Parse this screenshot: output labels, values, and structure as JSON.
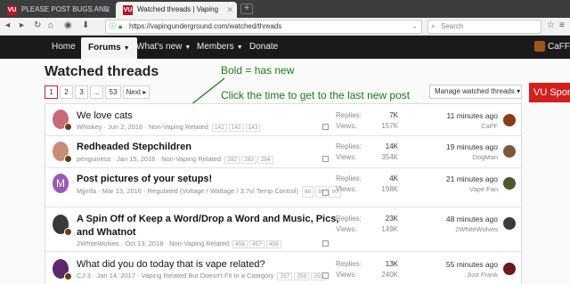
{
  "browser": {
    "tabs": [
      {
        "title": "PLEASE POST BUGS AND",
        "favicon": "VU"
      },
      {
        "title": "Watched threads | Vaping",
        "favicon": "VU"
      }
    ],
    "url": "https://vapingunderground.com/watched/threads",
    "search_placeholder": "Search"
  },
  "nav": {
    "items": [
      "Home",
      "Forums",
      "What's new",
      "Members",
      "Donate"
    ],
    "active": "Forums",
    "user": "CaFF"
  },
  "page": {
    "title": "Watched threads",
    "pagination": [
      "1",
      "2",
      "3",
      "...",
      "53"
    ],
    "next_label": "Next",
    "manage_label": "Manage watched threads",
    "sponsor_label": "VU Sponsors"
  },
  "annotations": {
    "bold_note": "Bold = has new",
    "time_note": "Click the time to get to the last new post"
  },
  "labels": {
    "replies": "Replies:",
    "views": "Views:"
  },
  "threads": [
    {
      "title": "We love cats",
      "bold": false,
      "author": "Whiskey",
      "date": "Jun 2, 2016",
      "forum": "Non-Vaping Related",
      "pages": [
        "141",
        "142",
        "143"
      ],
      "replies": "7K",
      "views": "157K",
      "when": "11 minutes ago",
      "last_user": "CaFF",
      "avatar_color": "#c66b7a",
      "last_color": "#8a3a1a"
    },
    {
      "title": "Redheaded Stepchildren",
      "bold": true,
      "author": "penguiness",
      "date": "Jan 15, 2016",
      "forum": "Non-Vaping Related",
      "pages": [
        "282",
        "283",
        "284"
      ],
      "replies": "14K",
      "views": "354K",
      "when": "19 minutes ago",
      "last_user": "DogMan",
      "avatar_color": "#c98c78",
      "last_color": "#7a5a3a"
    },
    {
      "title": "Post pictures of your setups!",
      "bold": true,
      "author": "Mjjmfa",
      "date": "Mar 13, 2016",
      "forum": "Regulated (Voltage / Wattage / 3.7v/ Temp Control)",
      "pages": [
        "88",
        "89",
        "90"
      ],
      "replies": "4K",
      "views": "198K",
      "when": "21 minutes ago",
      "last_user": "Vape Fan",
      "avatar_letter": "M",
      "last_color": "#4a5a2a"
    },
    {
      "title": "A Spin Off of Keep a Word/Drop a Word and Music, Pics, and Whatnot",
      "bold": true,
      "author": "2WhiteWolves",
      "date": "Oct 13, 2018",
      "forum": "Non-Vaping Related",
      "pages": [
        "456",
        "457",
        "458"
      ],
      "replies": "23K",
      "views": "149K",
      "when": "48 minutes ago",
      "last_user": "2WhiteWolves",
      "avatar_color": "#3a3a3a",
      "last_color": "#3a3a3a"
    },
    {
      "title": "What did you do today that is vape related?",
      "bold": false,
      "author": "CJ-3",
      "date": "Jan 14, 2017",
      "forum": "Vaping Related But Doesn't Fit In a Category",
      "pages": [
        "257",
        "258",
        "259"
      ],
      "replies": "13K",
      "views": "240K",
      "when": "55 minutes ago",
      "last_user": "Just Frank",
      "avatar_color": "#5a2a6a",
      "last_color": "#6a1a1a"
    }
  ],
  "colors": {
    "accent": "#b9262f",
    "annotation": "#1e7d1e",
    "nav_bg": "#1a1a1a"
  }
}
